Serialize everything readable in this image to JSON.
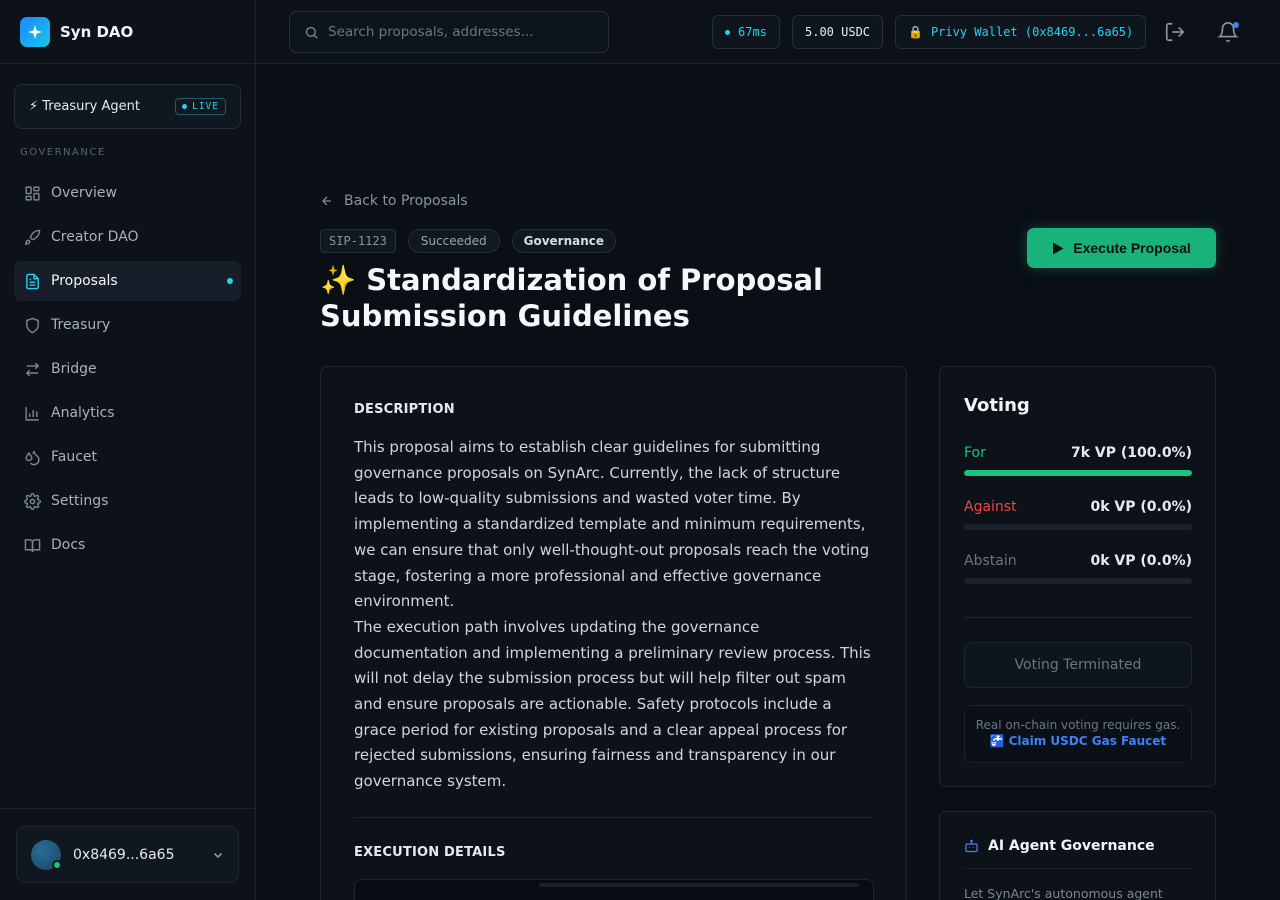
{
  "brand": {
    "name": "Syn DAO"
  },
  "agent": {
    "name": "⚡ Treasury Agent",
    "badge": "LIVE"
  },
  "sidebar": {
    "section_label": "GOVERNANCE",
    "items": [
      {
        "label": "Overview",
        "icon": "grid-icon"
      },
      {
        "label": "Creator DAO",
        "icon": "rocket-icon"
      },
      {
        "label": "Proposals",
        "icon": "document-icon",
        "active": true
      },
      {
        "label": "Treasury",
        "icon": "shield-icon"
      },
      {
        "label": "Bridge",
        "icon": "arrows-icon"
      },
      {
        "label": "Analytics",
        "icon": "chart-icon"
      },
      {
        "label": "Faucet",
        "icon": "droplet-icon"
      },
      {
        "label": "Settings",
        "icon": "gear-icon"
      },
      {
        "label": "Docs",
        "icon": "book-icon"
      }
    ]
  },
  "account": {
    "address": "0x8469...6a65"
  },
  "header": {
    "search_placeholder": "Search proposals, addresses...",
    "latency": "67ms",
    "balance": "5.00 USDC",
    "wallet": "Privy Wallet (0x8469...6a65)"
  },
  "proposal": {
    "back_label": "Back to Proposals",
    "id": "SIP-1123",
    "status": "Succeeded",
    "category": "Governance",
    "title": "✨ Standardization of Proposal Submission Guidelines",
    "execute_label": "Execute Proposal",
    "description_heading": "DESCRIPTION",
    "description_p1": "This proposal aims to establish clear guidelines for submitting governance proposals on SynArc. Currently, the lack of structure leads to low-quality submissions and wasted voter time. By implementing a standardized template and minimum requirements, we can ensure that only well-thought-out proposals reach the voting stage, fostering a more professional and effective governance environment.",
    "description_p2": "The execution path involves updating the governance documentation and implementing a preliminary review process. This will not delay the submission process but will help filter out spam and ensure proposals are actionable. Safety protocols include a grace period for existing proposals and a clear appeal process for rejected submissions, ensuring fairness and transparency in our governance system.",
    "execution_heading": "EXECUTION DETAILS"
  },
  "voting": {
    "title": "Voting",
    "for": {
      "label": "For",
      "value": "7k VP (100.0%)",
      "fraction": 1.0,
      "color": "#19c37d"
    },
    "against": {
      "label": "Against",
      "value": "0k VP (0.0%)",
      "fraction": 0.0,
      "color": "#ef4444"
    },
    "abstain": {
      "label": "Abstain",
      "value": "0k VP (0.0%)",
      "fraction": 0.0,
      "color": "#6b7482"
    },
    "terminated_label": "Voting Terminated",
    "gas_note": "Real on-chain voting requires gas.",
    "faucet_link": "Claim USDC Gas Faucet"
  },
  "ai_governance": {
    "title": "AI Agent Governance",
    "description": "Let SynArc's autonomous agent"
  },
  "colors": {
    "accent": "#22d3ee",
    "success": "#18b27a",
    "danger": "#ef4444",
    "link": "#3b82f6"
  }
}
